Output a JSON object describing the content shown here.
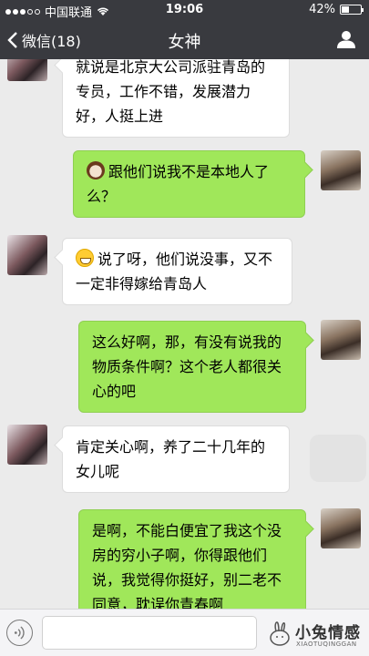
{
  "status_bar": {
    "carrier": "中国联通",
    "time": "19:06",
    "battery": "42%",
    "battery_level": 0.42
  },
  "nav": {
    "back_label": "微信(18)",
    "title": "女神",
    "profile_icon": "person-icon"
  },
  "messages": [
    {
      "side": "left",
      "avatar": "girl",
      "text": "就说是北京大公司派驻青岛的专员，工作不错，发展潜力好，人挺上进"
    },
    {
      "side": "right",
      "avatar": "man",
      "emoji": "cow-emoji",
      "text": "跟他们说我不是本地人了么？"
    },
    {
      "side": "left",
      "avatar": "girl",
      "emoji": "grin-emoji",
      "text": "说了呀，他们说没事，又不一定非得嫁给青岛人"
    },
    {
      "side": "right",
      "avatar": "man",
      "text": "这么好啊，那，有没有说我的物质条件啊？这个老人都很关心的吧"
    },
    {
      "side": "left",
      "avatar": "girl",
      "text": "肯定关心啊，养了二十几年的女儿呢"
    },
    {
      "side": "right",
      "avatar": "man",
      "text": "是啊，不能白便宜了我这个没房的穷小子啊，你得跟他们说，我觉得你挺好，别二老不同意，耽误你青春啊"
    }
  ],
  "input_bar": {
    "voice_icon": "voice-icon",
    "placeholder": ""
  },
  "watermark": {
    "title": "小兔情感",
    "subtitle": "XIAOTUQINGGAN"
  }
}
